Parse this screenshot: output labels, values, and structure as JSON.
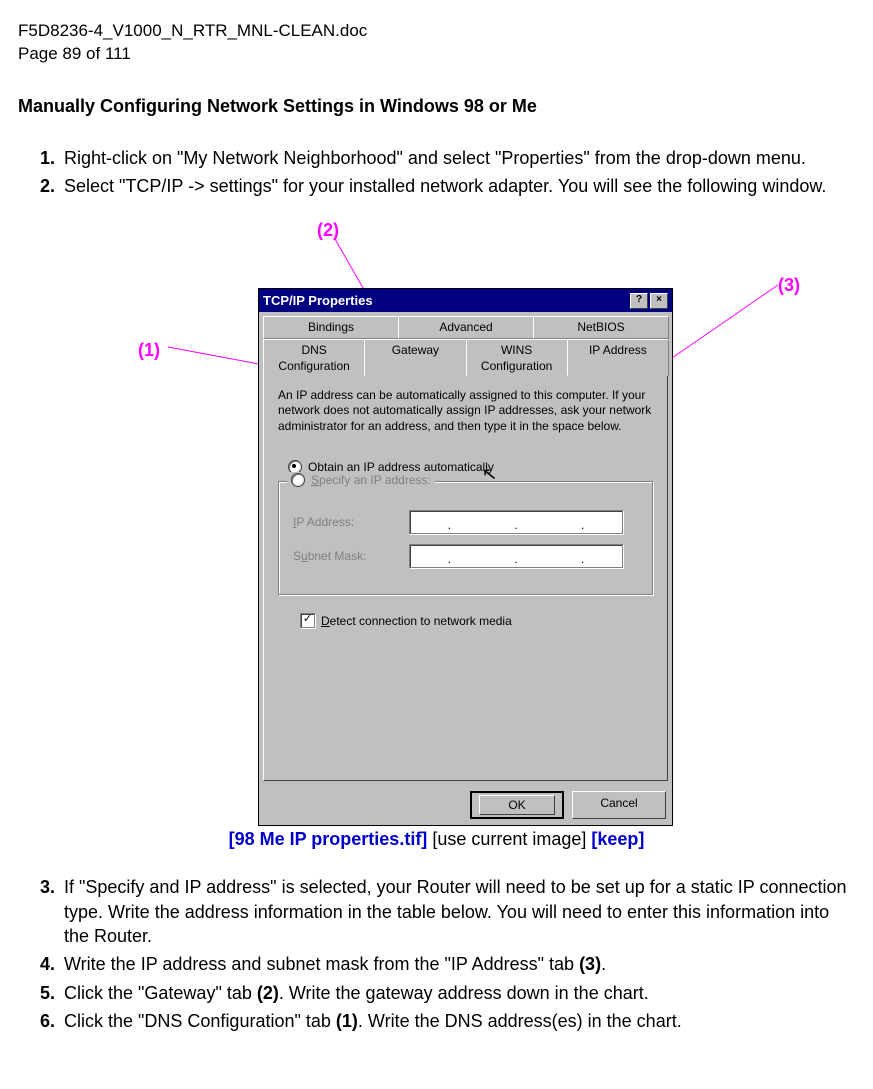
{
  "header": {
    "filename": "F5D8236-4_V1000_N_RTR_MNL-CLEAN.doc",
    "pageline": "Page 89 of 111"
  },
  "section_title": "Manually Configuring Network Settings in Windows 98 or Me",
  "steps": {
    "s1": "Right-click on \"My Network Neighborhood\" and select \"Properties\" from the drop-down menu.",
    "s2": "Select \"TCP/IP -> settings\" for your installed network adapter. You will see the following window.",
    "s3": "If \"Specify and IP address\" is selected, your Router will need to be set up for a static IP connection type. Write the address information in the table below. You will need to enter this information into the Router.",
    "s4_pre": "Write the IP address and subnet mask from the \"IP Address\" tab ",
    "s4_bold": "(3)",
    "s4_post": ".",
    "s5_pre": "Click the \"Gateway\" tab ",
    "s5_bold": "(2)",
    "s5_post": ". Write the gateway address down in the chart.",
    "s6_pre": "Click the \"DNS Configuration\" tab ",
    "s6_bold": "(1)",
    "s6_post": ". Write the DNS address(es) in the chart."
  },
  "callouts": {
    "c1": "(1)",
    "c2": "(2)",
    "c3": "(3)"
  },
  "dialog": {
    "title": "TCP/IP Properties",
    "help_btn": "?",
    "close_btn": "×",
    "tabs_row1": {
      "t1": "Bindings",
      "t2": "Advanced",
      "t3": "NetBIOS"
    },
    "tabs_row2": {
      "t1": "DNS Configuration",
      "t2": "Gateway",
      "t3": "WINS Configuration",
      "t4": "IP Address"
    },
    "helptext": "An IP address can be automatically assigned to this computer. If your network does not automatically assign IP addresses, ask your network administrator for an address, and then type it in the space below.",
    "radio_auto_pre": "O",
    "radio_auto_label": "btain an IP address automatically",
    "radio_spec_pre": "S",
    "radio_spec_label": "pecify an IP address:",
    "iplabel_pre": "I",
    "iplabel_post": "P Address:",
    "smlabel_pre": "S",
    "smlabel_mid": "u",
    "smlabel_post": "bnet Mask:",
    "dot": ".",
    "detect_pre": "D",
    "detect_label": "etect connection to network media",
    "ok": "OK",
    "cancel": "Cancel"
  },
  "caption": {
    "file": "[98 Me IP properties.tif]",
    "note": " [use current image] ",
    "keep": "[keep]"
  }
}
